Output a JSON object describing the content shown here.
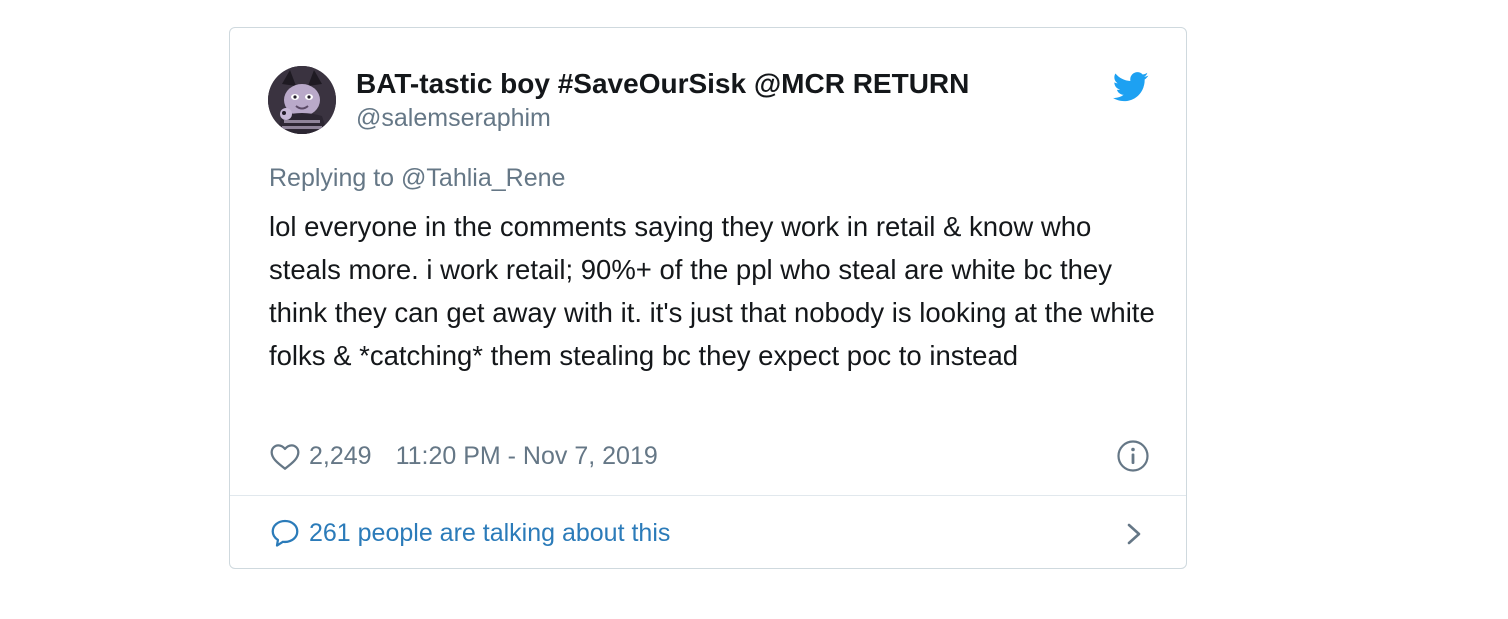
{
  "tweet": {
    "display_name": "BAT-tastic boy #SaveOurSisk @MCR RETURN",
    "handle": "@salemseraphim",
    "replying_prefix": "Replying to ",
    "replying_to": "@Tahlia_Rene",
    "text": "lol everyone in the comments saying they work in retail & know who steals more. i work retail; 90%+ of the ppl who steal are white bc they think they can get away with it. it's just that nobody is looking at the white folks & *catching* them stealing bc they expect poc to instead",
    "like_count": "2,249",
    "timestamp": "11:20 PM - Nov 7, 2019",
    "conversation_label": "261 people are talking about this"
  },
  "icons": {
    "brand": "twitter-bird-icon",
    "like": "heart-icon",
    "info": "info-icon",
    "conversation": "speech-bubble-icon",
    "navigate": "chevron-right-icon"
  },
  "colors": {
    "twitter_blue": "#1da1f2",
    "link_blue": "#2b7bb9",
    "text_primary": "#14171a",
    "text_secondary": "#657786",
    "border": "#cfd9de"
  }
}
